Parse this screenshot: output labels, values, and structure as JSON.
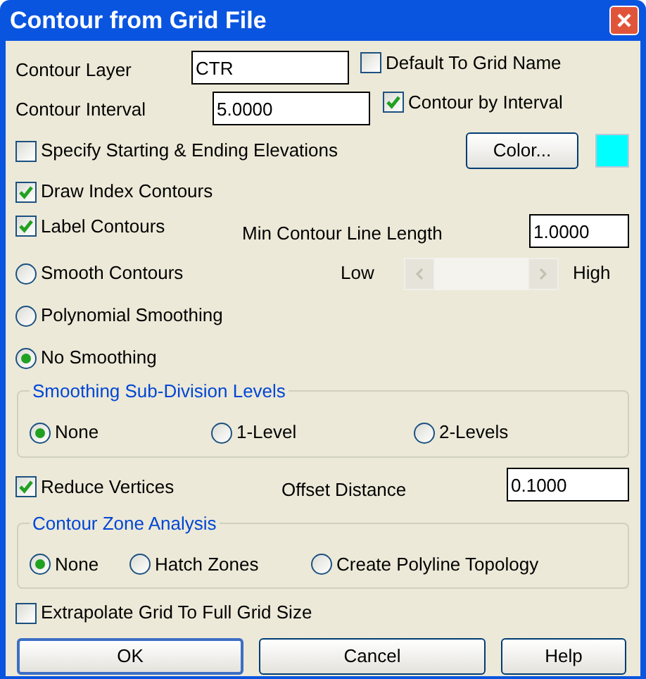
{
  "window": {
    "title": "Contour from Grid File"
  },
  "contour_layer": {
    "label": "Contour Layer",
    "value": "CTR"
  },
  "default_to_grid_name": {
    "label": "Default To Grid Name",
    "checked": false
  },
  "contour_interval": {
    "label": "Contour Interval",
    "value": "5.0000"
  },
  "contour_by_interval": {
    "label": "Contour by Interval",
    "checked": true
  },
  "specify_elevations": {
    "label": "Specify Starting & Ending Elevations",
    "checked": false
  },
  "color_button": {
    "label": "Color...",
    "color": "#00ffff"
  },
  "draw_index_contours": {
    "label": "Draw Index Contours",
    "checked": true
  },
  "label_contours": {
    "label": "Label Contours",
    "checked": true
  },
  "min_contour_line_length": {
    "label": "Min Contour Line Length",
    "value": "1.0000"
  },
  "smoothing": [
    {
      "label": "Smooth Contours",
      "selected": false
    },
    {
      "label": "Polynomial Smoothing",
      "selected": false
    },
    {
      "label": "No Smoothing",
      "selected": true
    }
  ],
  "smoothing_slider": {
    "low_label": "Low",
    "high_label": "High",
    "disabled": true
  },
  "sub_division": {
    "title": "Smoothing Sub-Division Levels",
    "options": [
      {
        "label": "None",
        "selected": true
      },
      {
        "label": "1-Level",
        "selected": false
      },
      {
        "label": "2-Levels",
        "selected": false
      }
    ]
  },
  "reduce_vertices": {
    "label": "Reduce Vertices",
    "checked": true
  },
  "offset_distance": {
    "label": "Offset Distance",
    "value": "0.1000"
  },
  "zone_analysis": {
    "title": "Contour Zone Analysis",
    "options": [
      {
        "label": "None",
        "selected": true
      },
      {
        "label": "Hatch Zones",
        "selected": false
      },
      {
        "label": "Create Polyline Topology",
        "selected": false
      }
    ]
  },
  "extrapolate": {
    "label": "Extrapolate Grid To Full Grid Size",
    "checked": false
  },
  "buttons": [
    {
      "label": "OK",
      "default": true
    },
    {
      "label": "Cancel",
      "default": false
    },
    {
      "label": "Help",
      "default": false
    }
  ]
}
